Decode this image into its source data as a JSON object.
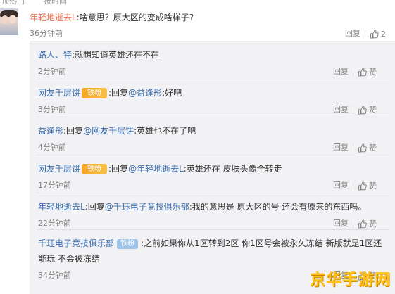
{
  "top_fragment": [
    "顶热门",
    "按时间"
  ],
  "main_comment": {
    "user": "年轻地逝去L",
    "text": ":啥意思？原大区的变成啥样子?",
    "time": "36分钟前",
    "reply": "回复",
    "like_count": "2"
  },
  "replies": [
    {
      "user": "路人、特",
      "text": ":就想知道英雄还在不在",
      "time": "2分钟前",
      "reply": "回复",
      "like": "赞"
    },
    {
      "user": "网友千层饼",
      "badge": "铁粉",
      "text_prefix": ":回复",
      "mention": "@益逢彤",
      "text": ":好吧",
      "time": "3分钟前",
      "reply": "回复",
      "like": "赞"
    },
    {
      "user": "益逢彤",
      "text_prefix": ":回复",
      "mention": "@网友千层饼",
      "text": ":英雄也不在了吧",
      "time": "4分钟前",
      "reply": "回复",
      "like": "赞"
    },
    {
      "user": "网友千层饼",
      "badge": "铁粉",
      "text_prefix": ":回复",
      "mention": "@年轻地逝去L",
      "text": ":英雄还在 皮肤头像全转走",
      "time": "17分钟前",
      "reply": "回复",
      "like": "赞"
    },
    {
      "user": "年轻地逝去L",
      "text_prefix": ":回复",
      "mention": "@千珏电子竞技俱乐部",
      "text": ":我的意思是 原大区的号 还会有原来的东西吗。",
      "time": "22分钟前",
      "reply": "回复",
      "like": "赞"
    },
    {
      "user": "千珏电子竞技俱乐部",
      "badge": "铁粉",
      "text": ":之前如果你从1区转到2区 你1区号会被永久冻结 新版就是1区还",
      "text2": "能玩 不会被冻结",
      "time": "34分钟前",
      "reply": "回复",
      "like": "赞"
    }
  ],
  "watermark": "京华手游网"
}
